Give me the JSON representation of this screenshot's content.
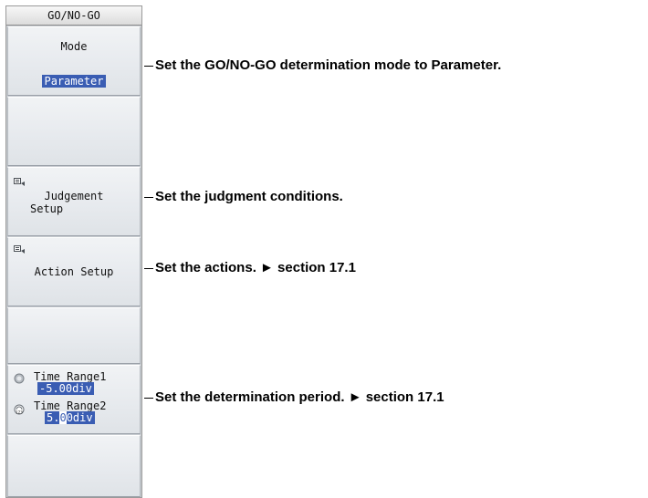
{
  "panel": {
    "title": "GO/NO-GO",
    "mode_label": "Mode",
    "mode_value": "Parameter",
    "judgement_label_line1": "Judgement",
    "judgement_label_line2": "Setup",
    "action_label": "Action Setup",
    "time_range1_label": "Time Range1",
    "time_range1_value": "-5.00div",
    "time_range2_label": "Time Range2",
    "time_range2_prefix": "5.",
    "time_range2_cursor_digit": "0",
    "time_range2_suffix": "0div"
  },
  "callouts": [
    {
      "text": "Set the GO/NO-GO determination mode to Parameter."
    },
    {
      "text": "Set the judgment conditions."
    },
    {
      "text": "Set the actions. ► section 17.1"
    },
    {
      "text": "Set the determination period. ► section 17.1"
    }
  ],
  "colors": {
    "highlight": "#3a5db3",
    "panel_bg": "#c9cdd2",
    "button_bg": "#e7eaee"
  },
  "icons": {
    "submenu": "submenu-icon",
    "knob": "knob-icon",
    "numeric_input": "numeric-icon"
  }
}
